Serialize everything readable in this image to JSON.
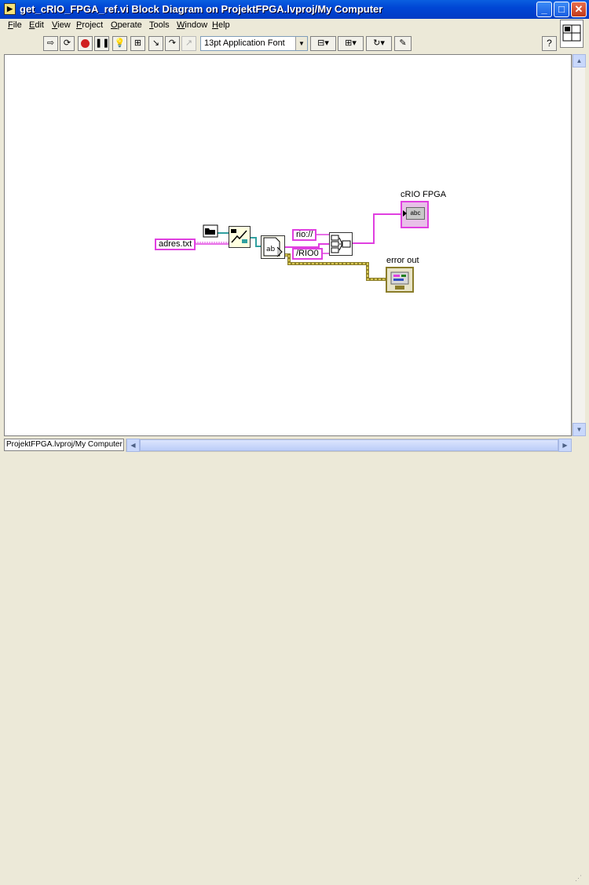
{
  "window": {
    "title": "get_cRIO_FPGA_ref.vi Block Diagram on ProjektFPGA.lvproj/My Computer",
    "app_icon": "labview-vi-icon"
  },
  "menu": [
    "File",
    "Edit",
    "View",
    "Project",
    "Operate",
    "Tools",
    "Window",
    "Help"
  ],
  "toolbar": {
    "font_select": "13pt Application Font",
    "icons": [
      "run-arrow-icon",
      "run-continuously-icon",
      "abort-icon",
      "pause-icon",
      "highlight-execution-icon",
      "retain-wire-values-icon",
      "step-into-icon",
      "step-over-icon",
      "step-out-icon",
      "align-objects-icon",
      "distribute-objects-icon",
      "reorder-icon",
      "cleanup-diagram-icon",
      "context-help-icon"
    ]
  },
  "diagram": {
    "path_constant": "adres.txt",
    "string_constant_1": "rio://",
    "string_constant_2": "/RIO0",
    "indicator_1_label": "cRIO FPGA",
    "indicator_1_type": "abc",
    "indicator_2_label": "error out"
  },
  "colors": {
    "string_wire": "#e040e0",
    "path_wire": "#30a0a0",
    "error_wire": "#8b7d2a"
  },
  "status": {
    "project_path": "ProjektFPGA.lvproj/My Computer"
  }
}
